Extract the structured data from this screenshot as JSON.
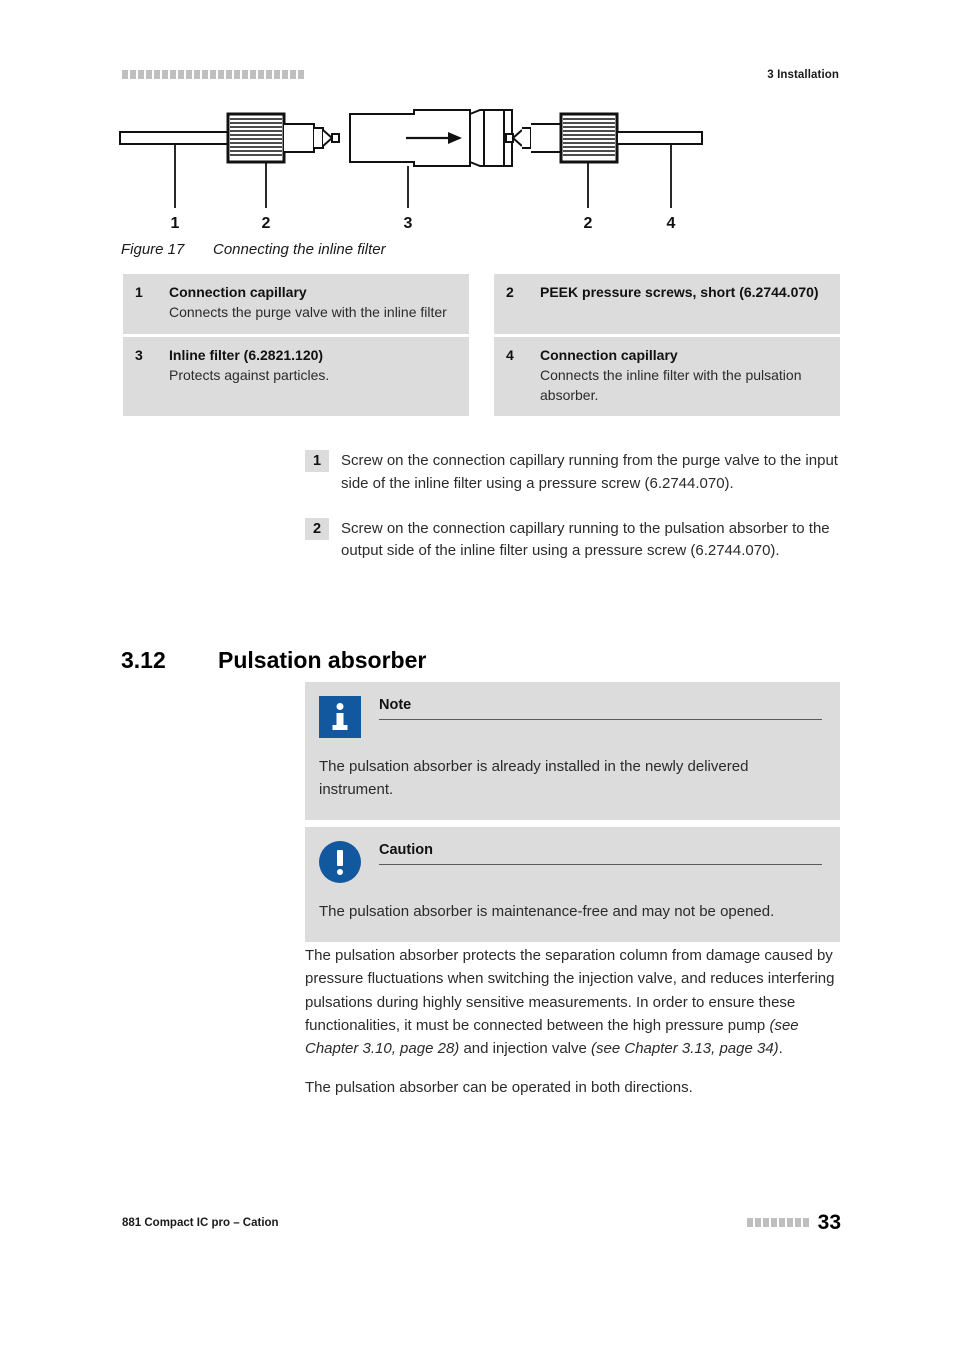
{
  "header": {
    "chapter": "3 Installation",
    "decor_squares": 23
  },
  "figure": {
    "label": "Figure 17",
    "caption": "Connecting the inline filter",
    "callout_numbers": [
      "1",
      "2",
      "3",
      "2",
      "4"
    ]
  },
  "legend": [
    {
      "num": "1",
      "title": "Connection capillary",
      "desc": "Connects the purge valve with the inline filter"
    },
    {
      "num": "2",
      "title": "PEEK pressure screws, short (6.2744.070)",
      "desc": ""
    },
    {
      "num": "3",
      "title": "Inline filter (6.2821.120)",
      "desc": "Protects against particles."
    },
    {
      "num": "4",
      "title": "Connection capillary",
      "desc": "Connects the inline filter with the pulsation absorber."
    }
  ],
  "steps": [
    {
      "num": "1",
      "text": "Screw on the connection capillary running from the purge valve to the input side of the inline filter using a pressure screw (6.2744.070)."
    },
    {
      "num": "2",
      "text": "Screw on the connection capillary running to the pulsation absorber to the output side of the inline filter using a pressure screw (6.2744.070)."
    }
  ],
  "section": {
    "number": "3.12",
    "title": "Pulsation absorber"
  },
  "note": {
    "icon": "info-icon",
    "title": "Note",
    "body": "The pulsation absorber is already installed in the newly delivered instrument."
  },
  "caution": {
    "icon": "exclamation-icon",
    "title": "Caution",
    "body": "The pulsation absorber is maintenance-free and may not be opened."
  },
  "body": {
    "para1_a": "The pulsation absorber protects the separation column from damage caused by pressure fluctuations when switching the injection valve, and reduces interfering pulsations during highly sensitive measurements. In order to ensure these functionalities, it must be connected between the high pressure pump ",
    "para1_ref1": "(see Chapter 3.10, page 28)",
    "para1_b": " and injection valve ",
    "para1_ref2": "(see Chapter 3.13, page 34)",
    "para1_c": ".",
    "para2": "The pulsation absorber can be operated in both directions."
  },
  "footer": {
    "document": "881 Compact IC pro – Cation",
    "page": "33",
    "decor_squares": 8
  },
  "colors": {
    "icon_blue": "#12589f",
    "panel_gray": "#dcdcdc",
    "decor_gray": "#bfbfbf"
  }
}
